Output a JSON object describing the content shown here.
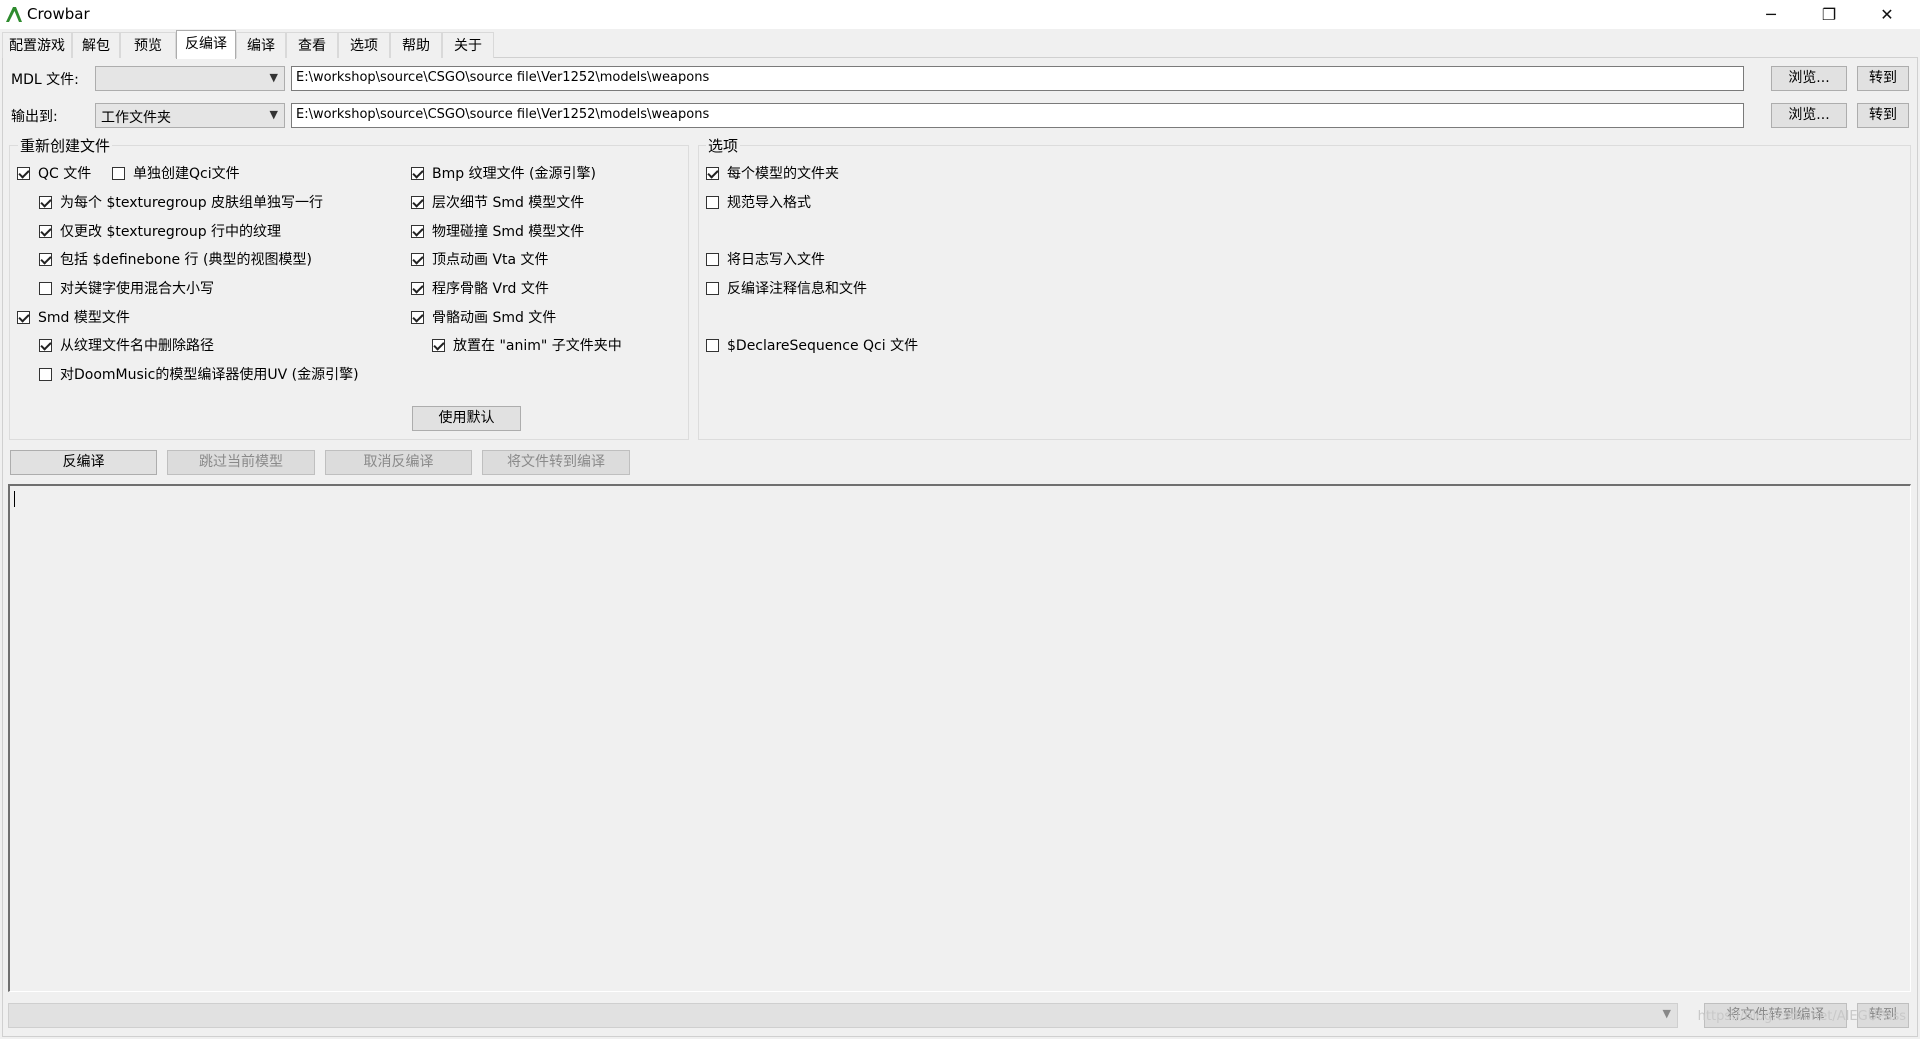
{
  "window": {
    "title": "Crowbar",
    "controls": {
      "minimize": "─",
      "restore": "❐",
      "close": "✕"
    }
  },
  "tabs": [
    {
      "label": "配置游戏"
    },
    {
      "label": "解包"
    },
    {
      "label": "预览"
    },
    {
      "label": "反编译"
    },
    {
      "label": "编译"
    },
    {
      "label": "查看"
    },
    {
      "label": "选项"
    },
    {
      "label": "帮助"
    },
    {
      "label": "关于"
    }
  ],
  "active_tab": "反编译",
  "mdl_row": {
    "label": "MDL 文件:",
    "combo_value": "",
    "path": "E:\\workshop\\source\\CSGO\\source file\\Ver1252\\models\\weapons",
    "browse": "浏览...",
    "goto": "转到"
  },
  "output_row": {
    "label": "输出到:",
    "combo_value": "工作文件夹",
    "path": "E:\\workshop\\source\\CSGO\\source file\\Ver1252\\models\\weapons",
    "browse": "浏览...",
    "goto": "转到"
  },
  "recreate_group": {
    "title": "重新创建文件",
    "left": [
      {
        "label": "QC 文件",
        "checked": true
      },
      {
        "label": "单独创建Qci文件",
        "checked": false
      },
      {
        "label": "为每个 $texturegroup 皮肤组单独写一行",
        "checked": true
      },
      {
        "label": "仅更改 $texturegroup 行中的纹理",
        "checked": true
      },
      {
        "label": "包括 $definebone 行 (典型的视图模型)",
        "checked": true
      },
      {
        "label": "对关键字使用混合大小写",
        "checked": false
      },
      {
        "label": "Smd 模型文件",
        "checked": true
      },
      {
        "label": "从纹理文件名中删除路径",
        "checked": true
      },
      {
        "label": "对DoomMusic的模型编译器使用UV (金源引擎)",
        "checked": false
      }
    ],
    "right": [
      {
        "label": "Bmp 纹理文件 (金源引擎)",
        "checked": true
      },
      {
        "label": "层次细节 Smd 模型文件",
        "checked": true
      },
      {
        "label": "物理碰撞 Smd 模型文件",
        "checked": true
      },
      {
        "label": "顶点动画 Vta 文件",
        "checked": true
      },
      {
        "label": "程序骨骼 Vrd 文件",
        "checked": true
      },
      {
        "label": "骨骼动画 Smd 文件",
        "checked": true
      },
      {
        "label": "放置在 \"anim\" 子文件夹中",
        "checked": true
      }
    ],
    "default_button": "使用默认"
  },
  "options_group": {
    "title": "选项",
    "items": [
      {
        "label": "每个模型的文件夹",
        "checked": true
      },
      {
        "label": "规范导入格式",
        "checked": false
      },
      {
        "label": "将日志写入文件",
        "checked": false
      },
      {
        "label": "反编译注释信息和文件",
        "checked": false
      },
      {
        "label": "$DeclareSequence Qci 文件",
        "checked": false
      }
    ]
  },
  "actions": {
    "decompile": "反编译",
    "skip": "跳过当前模型",
    "cancel": "取消反编译",
    "to_compile": "将文件转到编译"
  },
  "bottom": {
    "to_compile": "将文件转到编译",
    "goto": "转到",
    "watermark": "https://blog.csdn.net/AIEGUPass"
  }
}
